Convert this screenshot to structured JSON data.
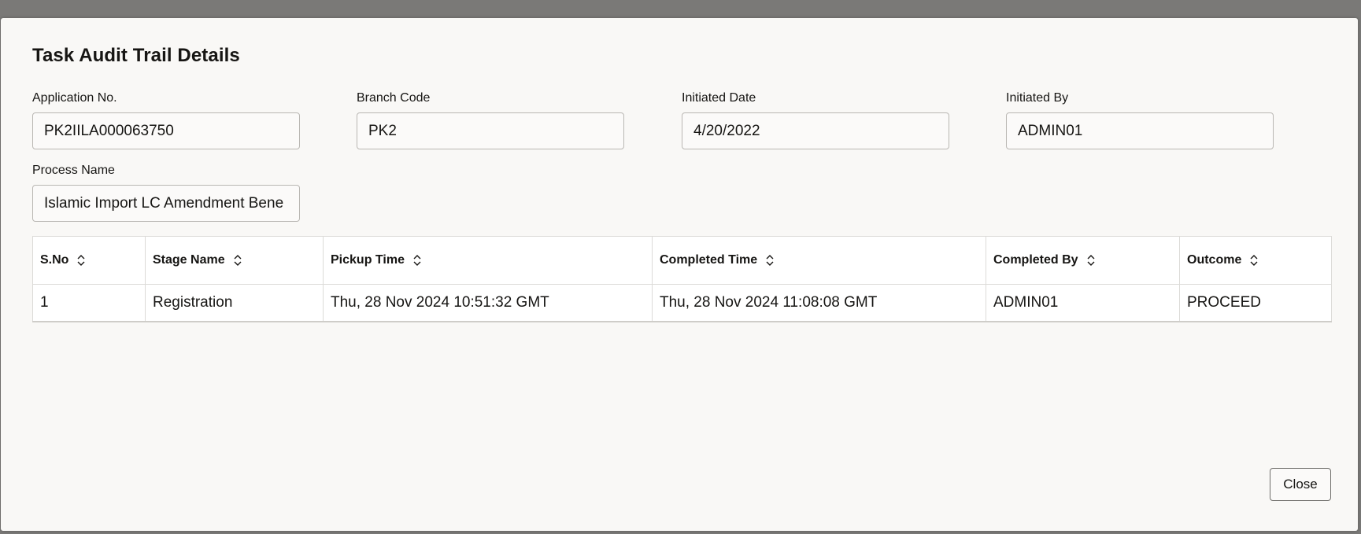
{
  "dialog": {
    "title": "Task Audit Trail Details",
    "close_label": "Close"
  },
  "fields": {
    "application_no": {
      "label": "Application No.",
      "value": "PK2IILA000063750"
    },
    "branch_code": {
      "label": "Branch Code",
      "value": "PK2"
    },
    "initiated_date": {
      "label": "Initiated Date",
      "value": "4/20/2022"
    },
    "initiated_by": {
      "label": "Initiated By",
      "value": "ADMIN01"
    },
    "process_name": {
      "label": "Process Name",
      "value": "Islamic Import LC Amendment Bene"
    }
  },
  "table": {
    "columns": [
      "S.No",
      "Stage Name",
      "Pickup Time",
      "Completed Time",
      "Completed By",
      "Outcome"
    ],
    "rows": [
      [
        "1",
        "Registration",
        "Thu, 28 Nov 2024 10:51:32 GMT",
        "Thu, 28 Nov 2024 11:08:08 GMT",
        "ADMIN01",
        "PROCEED"
      ]
    ]
  },
  "icons": {
    "sort": "sort-icon"
  }
}
